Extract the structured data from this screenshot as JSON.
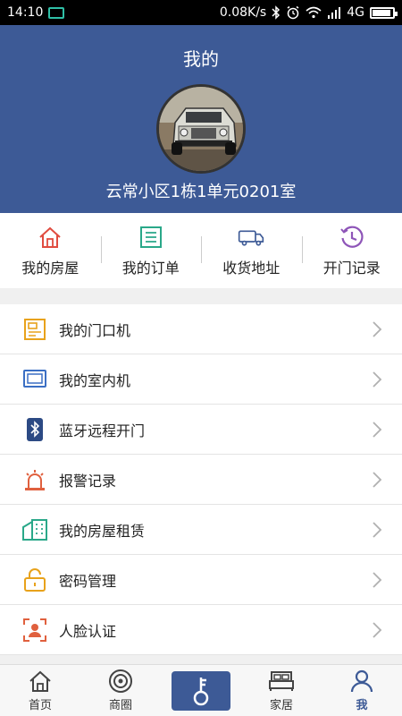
{
  "status_bar": {
    "time": "14:10",
    "speed": "0.08K/s",
    "network": "4G",
    "battery_level": 0.9
  },
  "header": {
    "title": "我的",
    "address": "云常小区1栋1单元0201室"
  },
  "quick_actions": [
    {
      "label": "我的房屋",
      "icon": "house-icon",
      "color": "#e04b3f"
    },
    {
      "label": "我的订单",
      "icon": "order-list-icon",
      "color": "#2aa889"
    },
    {
      "label": "收货地址",
      "icon": "delivery-truck-icon",
      "color": "#3d5a96"
    },
    {
      "label": "开门记录",
      "icon": "history-clock-icon",
      "color": "#8e55b8"
    }
  ],
  "menu": [
    {
      "label": "我的门口机",
      "icon": "door-panel-icon",
      "color": "#e8a21b"
    },
    {
      "label": "我的室内机",
      "icon": "monitor-icon",
      "color": "#3b6fc4"
    },
    {
      "label": "蓝牙远程开门",
      "icon": "bluetooth-icon",
      "color": "#2c4a84"
    },
    {
      "label": "报警记录",
      "icon": "alarm-light-icon",
      "color": "#e0603e"
    },
    {
      "label": "我的房屋租赁",
      "icon": "building-icon",
      "color": "#2aa889"
    },
    {
      "label": "密码管理",
      "icon": "lock-icon",
      "color": "#e8a21b"
    },
    {
      "label": "人脸认证",
      "icon": "face-scan-icon",
      "color": "#e0603e"
    }
  ],
  "bottom_nav": [
    {
      "label": "首页",
      "icon": "home-icon"
    },
    {
      "label": "商圈",
      "icon": "shop-circle-icon"
    },
    {
      "label": "",
      "icon": "key-icon"
    },
    {
      "label": "家居",
      "icon": "bed-icon"
    },
    {
      "label": "我",
      "icon": "person-icon",
      "active": true
    }
  ],
  "colors": {
    "primary": "#3d5a96",
    "background": "#f0f0f0"
  }
}
